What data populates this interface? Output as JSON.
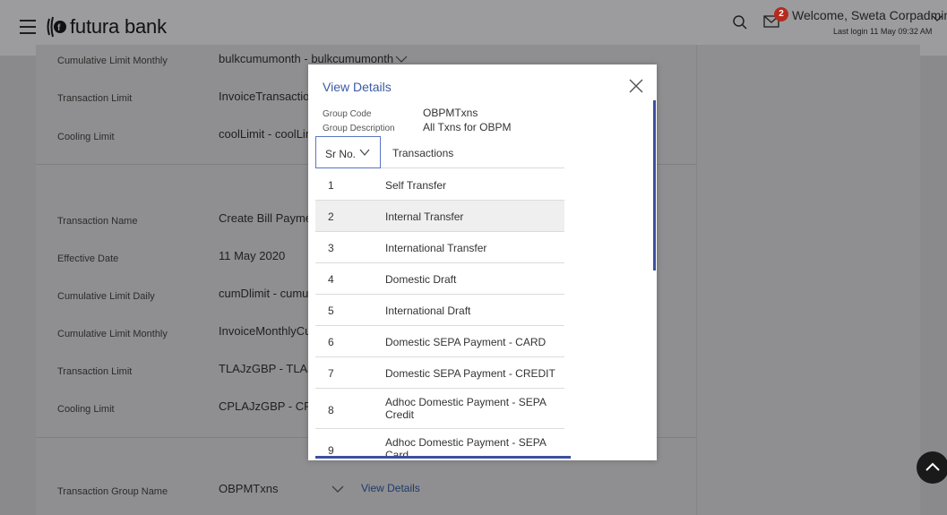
{
  "header": {
    "brand": "futura bank",
    "welcome": "Welcome, Sweta Corpadmin",
    "last_login": "Last login 11 May 09:32 AM",
    "notification_count": "2"
  },
  "form": {
    "section1": [
      {
        "label": "Cumulative Limit Monthly",
        "value": "bulkcumumonth - bulkcumumonth"
      },
      {
        "label": "Transaction Limit",
        "value": "InvoiceTransaction"
      },
      {
        "label": "Cooling Limit",
        "value": "coolLimit - coolLim"
      }
    ],
    "section2": [
      {
        "label": "Transaction Name",
        "value": "Create Bill Payment"
      },
      {
        "label": "Effective Date",
        "value": "11 May 2020"
      },
      {
        "label": "Cumulative Limit Daily",
        "value": "cumDlimit - cumula"
      },
      {
        "label": "Cumulative Limit Monthly",
        "value": "InvoiceMonthlyCun"
      },
      {
        "label": "Transaction Limit",
        "value": "TLAJzGBP - TLAJz("
      },
      {
        "label": "Cooling Limit",
        "value": "CPLAJzGBP - CPLA"
      }
    ],
    "group": {
      "label": "Transaction Group Name",
      "value": "OBPMTxns",
      "link": "View Details"
    }
  },
  "modal": {
    "title": "View Details",
    "group_code_label": "Group Code",
    "group_code": "OBPMTxns",
    "group_desc_label": "Group Description",
    "group_desc": "All Txns for OBPM",
    "col_sr": "Sr No.",
    "col_tx": "Transactions",
    "rows": [
      {
        "sr": "1",
        "tx": "Self Transfer"
      },
      {
        "sr": "2",
        "tx": "Internal Transfer"
      },
      {
        "sr": "3",
        "tx": "International Transfer"
      },
      {
        "sr": "4",
        "tx": "Domestic Draft"
      },
      {
        "sr": "5",
        "tx": "International Draft"
      },
      {
        "sr": "6",
        "tx": "Domestic SEPA Payment - CARD"
      },
      {
        "sr": "7",
        "tx": "Domestic SEPA Payment - CREDIT"
      },
      {
        "sr": "8",
        "tx": "Adhoc Domestic Payment - SEPA Credit"
      },
      {
        "sr": "9",
        "tx": "Adhoc Domestic Payment - SEPA Card"
      }
    ]
  },
  "colors": {
    "accent": "#3b5aa3",
    "badge": "#b52b1e",
    "overlay": "#8a8a8c"
  }
}
